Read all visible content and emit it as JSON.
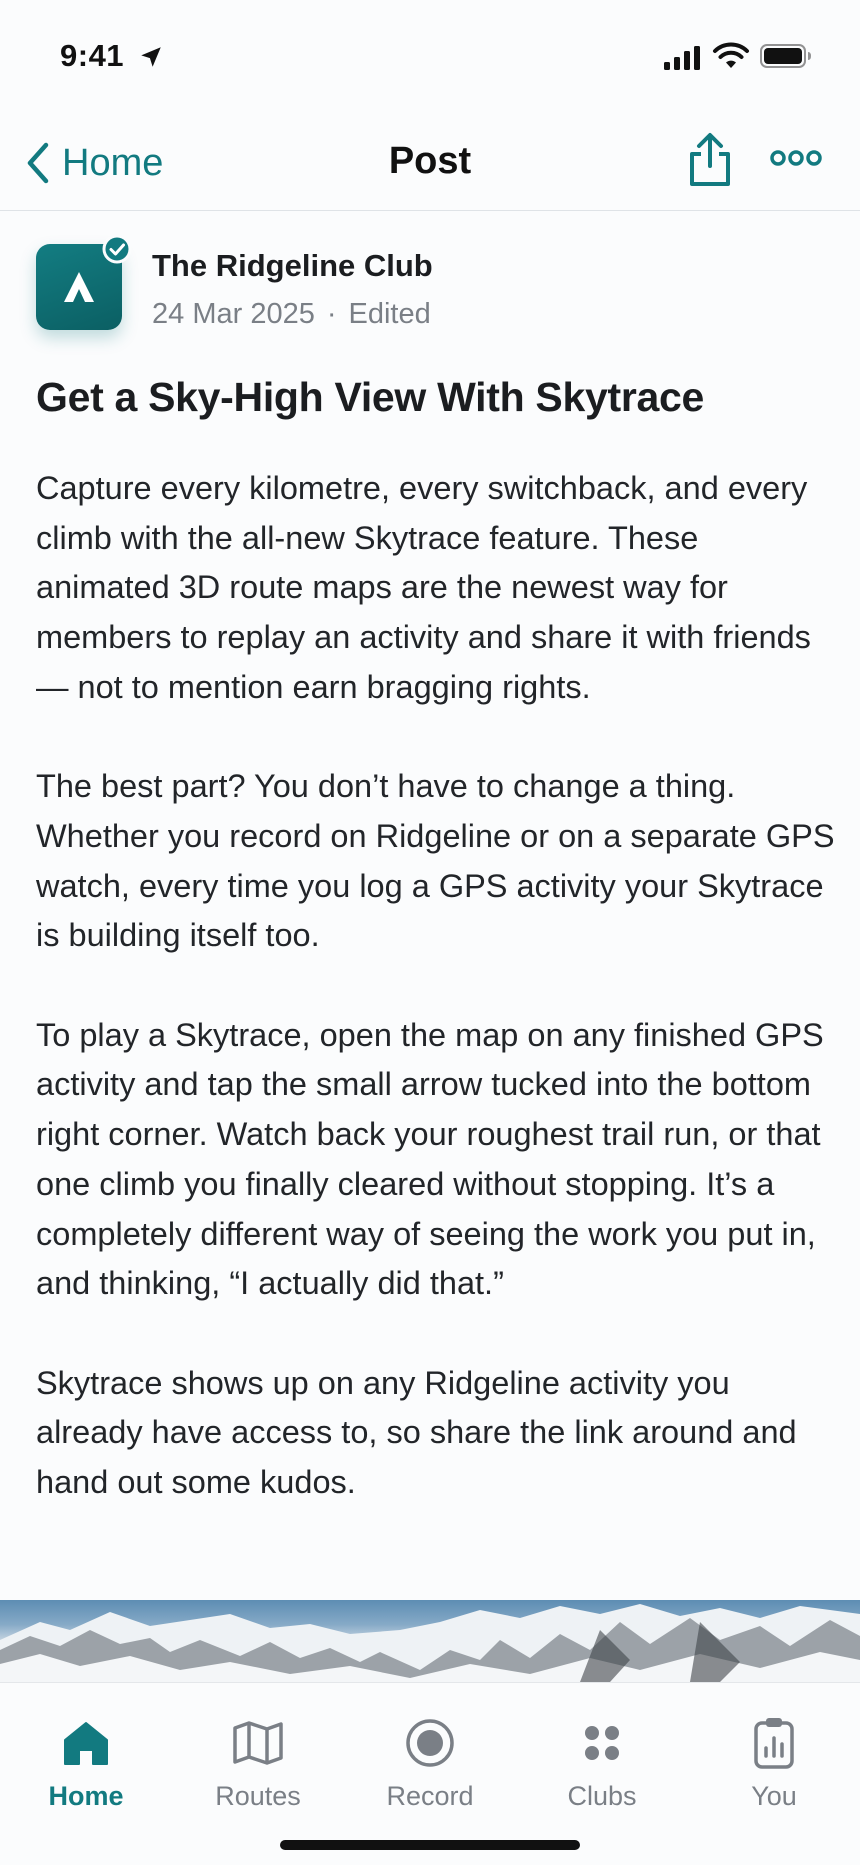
{
  "status_bar": {
    "time": "9:41"
  },
  "nav": {
    "back_label": "Home",
    "title": "Post",
    "share_icon": "share-icon",
    "more_icon": "more-icon"
  },
  "post": {
    "club_name": "The Ridgeline Club",
    "date": "24 Mar 2025",
    "separator": "·",
    "edited": "Edited",
    "title": "Get a Sky-High View With Skytrace",
    "paragraphs": [
      "Capture every kilometre, every switchback, and every climb with the all-new Skytrace feature. These animated 3D route maps are the newest way for members to replay an activity and share it with friends — not to mention earn bragging rights.",
      "The best part? You don’t have to change a thing. Whether you record on Ridgeline or on a separate GPS watch, every time you log a GPS activity your Skytrace is building itself too.",
      "To play a Skytrace, open the map on any finished GPS activity and tap the small arrow tucked into the bottom right corner. Watch back your roughest trail run, or that one climb you finally cleared without stopping. It’s a completely different way of seeing the work you put in, and thinking, “I actually did that.”",
      "Skytrace shows up on any Ridgeline activity you already have access to, so share the link around and hand out some kudos."
    ]
  },
  "tabs": [
    {
      "label": "Home",
      "icon": "home-icon",
      "active": true
    },
    {
      "label": "Routes",
      "icon": "map-icon",
      "active": false
    },
    {
      "label": "Record",
      "icon": "record-icon",
      "active": false
    },
    {
      "label": "Clubs",
      "icon": "clubs-icon",
      "active": false
    },
    {
      "label": "You",
      "icon": "clipboard-icon",
      "active": false
    }
  ],
  "colors": {
    "accent": "#127a80",
    "muted": "#7a7f86",
    "text": "#1b1d20"
  }
}
